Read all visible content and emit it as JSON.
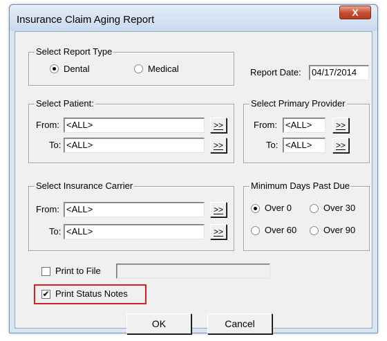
{
  "window": {
    "title": "Insurance Claim Aging Report",
    "close_label": "X"
  },
  "report_type": {
    "legend": "Select Report Type",
    "dental_label": "Dental",
    "medical_label": "Medical",
    "selected": "Dental"
  },
  "report_date": {
    "label": "Report Date:",
    "value": "04/17/2014"
  },
  "patient": {
    "legend": "Select Patient:",
    "from_label": "From:",
    "from_value": "<ALL>",
    "to_label": "To:",
    "to_value": "<ALL>"
  },
  "provider": {
    "legend": "Select Primary Provider",
    "from_label": "From:",
    "from_value": "<ALL>",
    "to_label": "To:",
    "to_value": "<ALL>"
  },
  "carrier": {
    "legend": "Select Insurance Carrier",
    "from_label": "From:",
    "from_value": "<ALL>",
    "to_label": "To:",
    "to_value": "<ALL>"
  },
  "days_past_due": {
    "legend": "Minimum Days Past Due",
    "options": [
      "Over 0",
      "Over 30",
      "Over 60",
      "Over 90"
    ],
    "selected": "Over 0"
  },
  "lookup_button_label": ">>",
  "print_to_file": {
    "label": "Print to File",
    "checked": false,
    "value": ""
  },
  "print_status_notes": {
    "label": "Print Status Notes",
    "checked": true,
    "check_glyph": "✔"
  },
  "buttons": {
    "ok": "OK",
    "cancel": "Cancel"
  },
  "colors": {
    "highlight": "#d42020",
    "dialog_bg": "#f0f0f0",
    "titlebar": "#c9d9ee",
    "close": "#c44c31"
  }
}
